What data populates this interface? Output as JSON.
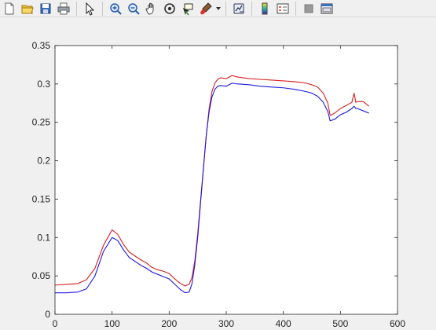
{
  "toolbar": {
    "buttons": [
      {
        "name": "new-figure-icon"
      },
      {
        "name": "open-file-icon"
      },
      {
        "name": "save-figure-icon"
      },
      {
        "name": "print-figure-icon"
      },
      {
        "sep": true
      },
      {
        "name": "edit-plot-arrow-icon"
      },
      {
        "sep": true
      },
      {
        "name": "zoom-in-icon"
      },
      {
        "name": "zoom-out-icon"
      },
      {
        "name": "pan-hand-icon"
      },
      {
        "name": "rotate-3d-icon"
      },
      {
        "name": "data-cursor-icon"
      },
      {
        "name": "brush-icon",
        "caret": true
      },
      {
        "sep": true
      },
      {
        "name": "link-plot-icon"
      },
      {
        "sep": true
      },
      {
        "name": "insert-colorbar-icon"
      },
      {
        "name": "insert-legend-icon"
      },
      {
        "sep": true
      },
      {
        "name": "hide-plot-tools-icon"
      },
      {
        "name": "show-plot-tools-icon"
      }
    ]
  },
  "colors": {
    "series_red": "#d62020",
    "series_blue": "#1a1adf",
    "axes": "#262626"
  },
  "chart_data": {
    "type": "line",
    "title": "",
    "xlabel": "",
    "ylabel": "",
    "xlim": [
      0,
      600
    ],
    "ylim": [
      0,
      0.35
    ],
    "xticks": [
      "0",
      "100",
      "200",
      "300",
      "400",
      "500",
      "600"
    ],
    "yticks": [
      "0",
      "0.05",
      "0.1",
      "0.15",
      "0.2",
      "0.25",
      "0.3",
      "0.35"
    ],
    "grid": false,
    "series": [
      {
        "color": "#d62020",
        "x": [
          0,
          20,
          40,
          55,
          70,
          85,
          100,
          110,
          120,
          130,
          140,
          150,
          160,
          170,
          180,
          190,
          200,
          210,
          220,
          228,
          235,
          240,
          245,
          250,
          255,
          260,
          265,
          270,
          275,
          280,
          285,
          290,
          300,
          310,
          320,
          340,
          360,
          380,
          400,
          420,
          440,
          450,
          460,
          470,
          478,
          482,
          490,
          500,
          510,
          520,
          524,
          527,
          530,
          540,
          550
        ],
        "y": [
          0.038,
          0.039,
          0.04,
          0.045,
          0.06,
          0.09,
          0.11,
          0.104,
          0.091,
          0.081,
          0.076,
          0.071,
          0.067,
          0.061,
          0.058,
          0.056,
          0.053,
          0.046,
          0.04,
          0.037,
          0.039,
          0.048,
          0.07,
          0.105,
          0.148,
          0.19,
          0.233,
          0.268,
          0.29,
          0.301,
          0.306,
          0.308,
          0.307,
          0.311,
          0.309,
          0.307,
          0.306,
          0.305,
          0.304,
          0.303,
          0.301,
          0.299,
          0.296,
          0.288,
          0.275,
          0.259,
          0.262,
          0.268,
          0.272,
          0.276,
          0.288,
          0.276,
          0.277,
          0.277,
          0.271
        ]
      },
      {
        "color": "#1a1adf",
        "x": [
          0,
          20,
          40,
          55,
          70,
          85,
          100,
          110,
          120,
          130,
          140,
          150,
          160,
          170,
          180,
          190,
          200,
          210,
          220,
          228,
          235,
          240,
          245,
          250,
          255,
          260,
          265,
          270,
          275,
          280,
          285,
          290,
          300,
          310,
          320,
          340,
          360,
          380,
          400,
          420,
          440,
          450,
          460,
          470,
          478,
          482,
          490,
          500,
          510,
          520,
          524,
          527,
          530,
          540,
          550
        ],
        "y": [
          0.028,
          0.028,
          0.029,
          0.033,
          0.05,
          0.082,
          0.1,
          0.096,
          0.084,
          0.074,
          0.069,
          0.064,
          0.06,
          0.055,
          0.052,
          0.049,
          0.046,
          0.039,
          0.032,
          0.028,
          0.029,
          0.04,
          0.065,
          0.1,
          0.145,
          0.19,
          0.233,
          0.264,
          0.283,
          0.293,
          0.297,
          0.298,
          0.297,
          0.301,
          0.3,
          0.299,
          0.297,
          0.296,
          0.295,
          0.293,
          0.29,
          0.288,
          0.284,
          0.276,
          0.264,
          0.252,
          0.254,
          0.26,
          0.263,
          0.268,
          0.271,
          0.268,
          0.268,
          0.265,
          0.262
        ]
      }
    ]
  }
}
